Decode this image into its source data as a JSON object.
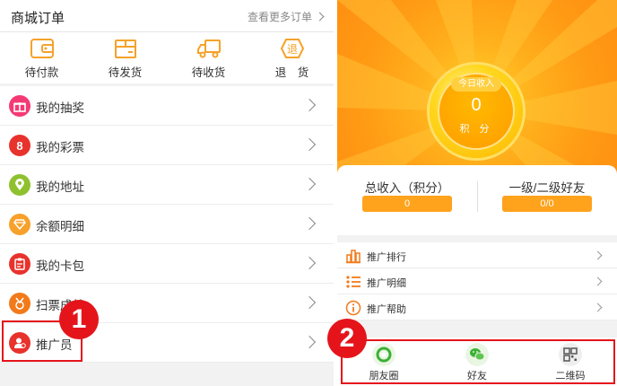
{
  "orders": {
    "title": "商城订单",
    "more_label": "查看更多订单",
    "items": [
      {
        "label": "待付款",
        "icon": "wallet-icon"
      },
      {
        "label": "待发货",
        "icon": "package-icon"
      },
      {
        "label": "待收货",
        "icon": "truck-icon"
      },
      {
        "label": "退　货",
        "icon": "return-icon"
      }
    ]
  },
  "menu": {
    "items": [
      {
        "label": "我的抽奖",
        "icon": "gift-icon",
        "color": "#f43a74"
      },
      {
        "label": "我的彩票",
        "icon": "lottery-icon",
        "color": "#e8322c",
        "glyph": "8"
      },
      {
        "label": "我的地址",
        "icon": "location-pin-icon",
        "color": "#8fc12f"
      },
      {
        "label": "余额明细",
        "icon": "diamond-icon",
        "color": "#f7a12a"
      },
      {
        "label": "我的卡包",
        "icon": "card-pack-icon",
        "color": "#e8322c"
      },
      {
        "label": "扫票成就",
        "icon": "medal-icon",
        "color": "#f27a1a"
      },
      {
        "label": "推广员",
        "icon": "promoter-icon",
        "color": "#e8322c"
      }
    ]
  },
  "callouts": {
    "first": "1",
    "second": "2"
  },
  "earnings": {
    "today_label": "今日收入",
    "today_value": "0",
    "unit": "积 分",
    "total_label": "总收入（积分）",
    "total_value": "0",
    "friends_label": "一级/二级好友",
    "friends_value": "0/0"
  },
  "promo_menu": {
    "items": [
      {
        "label": "推广排行",
        "icon": "bar-chart-icon"
      },
      {
        "label": "推广明细",
        "icon": "list-icon"
      },
      {
        "label": "推广帮助",
        "icon": "info-icon"
      }
    ]
  },
  "share": {
    "items": [
      {
        "label": "朋友圈",
        "icon": "moments-icon"
      },
      {
        "label": "好友",
        "icon": "wechat-icon"
      },
      {
        "label": "二维码",
        "icon": "qrcode-icon"
      }
    ]
  },
  "colors": {
    "accent_orange": "#ff9a14",
    "callout_red": "#e5141b",
    "icon_orange": "#f5a22a"
  }
}
